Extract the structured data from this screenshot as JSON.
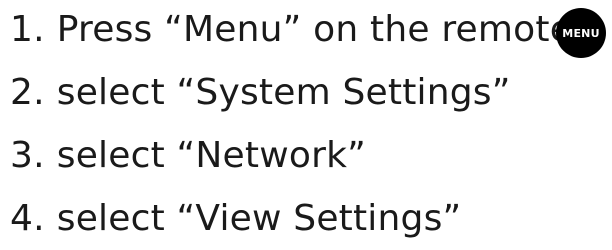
{
  "steps": [
    {
      "number": "1.",
      "text": "Press “Menu” on the remote"
    },
    {
      "number": "2.",
      "text": "select “System Settings”"
    },
    {
      "number": "3.",
      "text": "select “Network”"
    },
    {
      "number": "4.",
      "text": "select “View Settings”"
    }
  ],
  "menu_badge": {
    "label": "MENU",
    "background": "#000000",
    "text_color": "#ffffff"
  }
}
